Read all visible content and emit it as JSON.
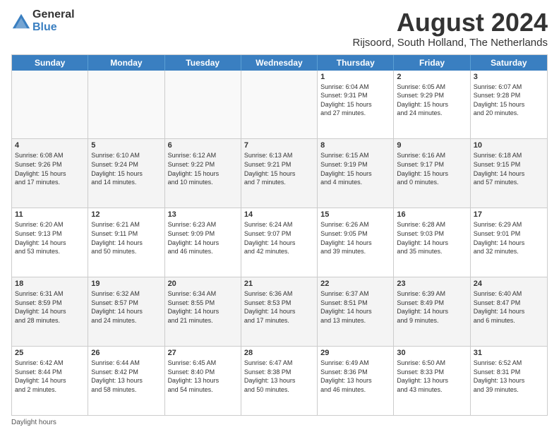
{
  "logo": {
    "general": "General",
    "blue": "Blue"
  },
  "title": {
    "month_year": "August 2024",
    "location": "Rijsoord, South Holland, The Netherlands"
  },
  "calendar": {
    "headers": [
      "Sunday",
      "Monday",
      "Tuesday",
      "Wednesday",
      "Thursday",
      "Friday",
      "Saturday"
    ],
    "footer": "Daylight hours",
    "rows": [
      [
        {
          "day": "",
          "info": ""
        },
        {
          "day": "",
          "info": ""
        },
        {
          "day": "",
          "info": ""
        },
        {
          "day": "",
          "info": ""
        },
        {
          "day": "1",
          "info": "Sunrise: 6:04 AM\nSunset: 9:31 PM\nDaylight: 15 hours\nand 27 minutes."
        },
        {
          "day": "2",
          "info": "Sunrise: 6:05 AM\nSunset: 9:29 PM\nDaylight: 15 hours\nand 24 minutes."
        },
        {
          "day": "3",
          "info": "Sunrise: 6:07 AM\nSunset: 9:28 PM\nDaylight: 15 hours\nand 20 minutes."
        }
      ],
      [
        {
          "day": "4",
          "info": "Sunrise: 6:08 AM\nSunset: 9:26 PM\nDaylight: 15 hours\nand 17 minutes."
        },
        {
          "day": "5",
          "info": "Sunrise: 6:10 AM\nSunset: 9:24 PM\nDaylight: 15 hours\nand 14 minutes."
        },
        {
          "day": "6",
          "info": "Sunrise: 6:12 AM\nSunset: 9:22 PM\nDaylight: 15 hours\nand 10 minutes."
        },
        {
          "day": "7",
          "info": "Sunrise: 6:13 AM\nSunset: 9:21 PM\nDaylight: 15 hours\nand 7 minutes."
        },
        {
          "day": "8",
          "info": "Sunrise: 6:15 AM\nSunset: 9:19 PM\nDaylight: 15 hours\nand 4 minutes."
        },
        {
          "day": "9",
          "info": "Sunrise: 6:16 AM\nSunset: 9:17 PM\nDaylight: 15 hours\nand 0 minutes."
        },
        {
          "day": "10",
          "info": "Sunrise: 6:18 AM\nSunset: 9:15 PM\nDaylight: 14 hours\nand 57 minutes."
        }
      ],
      [
        {
          "day": "11",
          "info": "Sunrise: 6:20 AM\nSunset: 9:13 PM\nDaylight: 14 hours\nand 53 minutes."
        },
        {
          "day": "12",
          "info": "Sunrise: 6:21 AM\nSunset: 9:11 PM\nDaylight: 14 hours\nand 50 minutes."
        },
        {
          "day": "13",
          "info": "Sunrise: 6:23 AM\nSunset: 9:09 PM\nDaylight: 14 hours\nand 46 minutes."
        },
        {
          "day": "14",
          "info": "Sunrise: 6:24 AM\nSunset: 9:07 PM\nDaylight: 14 hours\nand 42 minutes."
        },
        {
          "day": "15",
          "info": "Sunrise: 6:26 AM\nSunset: 9:05 PM\nDaylight: 14 hours\nand 39 minutes."
        },
        {
          "day": "16",
          "info": "Sunrise: 6:28 AM\nSunset: 9:03 PM\nDaylight: 14 hours\nand 35 minutes."
        },
        {
          "day": "17",
          "info": "Sunrise: 6:29 AM\nSunset: 9:01 PM\nDaylight: 14 hours\nand 32 minutes."
        }
      ],
      [
        {
          "day": "18",
          "info": "Sunrise: 6:31 AM\nSunset: 8:59 PM\nDaylight: 14 hours\nand 28 minutes."
        },
        {
          "day": "19",
          "info": "Sunrise: 6:32 AM\nSunset: 8:57 PM\nDaylight: 14 hours\nand 24 minutes."
        },
        {
          "day": "20",
          "info": "Sunrise: 6:34 AM\nSunset: 8:55 PM\nDaylight: 14 hours\nand 21 minutes."
        },
        {
          "day": "21",
          "info": "Sunrise: 6:36 AM\nSunset: 8:53 PM\nDaylight: 14 hours\nand 17 minutes."
        },
        {
          "day": "22",
          "info": "Sunrise: 6:37 AM\nSunset: 8:51 PM\nDaylight: 14 hours\nand 13 minutes."
        },
        {
          "day": "23",
          "info": "Sunrise: 6:39 AM\nSunset: 8:49 PM\nDaylight: 14 hours\nand 9 minutes."
        },
        {
          "day": "24",
          "info": "Sunrise: 6:40 AM\nSunset: 8:47 PM\nDaylight: 14 hours\nand 6 minutes."
        }
      ],
      [
        {
          "day": "25",
          "info": "Sunrise: 6:42 AM\nSunset: 8:44 PM\nDaylight: 14 hours\nand 2 minutes."
        },
        {
          "day": "26",
          "info": "Sunrise: 6:44 AM\nSunset: 8:42 PM\nDaylight: 13 hours\nand 58 minutes."
        },
        {
          "day": "27",
          "info": "Sunrise: 6:45 AM\nSunset: 8:40 PM\nDaylight: 13 hours\nand 54 minutes."
        },
        {
          "day": "28",
          "info": "Sunrise: 6:47 AM\nSunset: 8:38 PM\nDaylight: 13 hours\nand 50 minutes."
        },
        {
          "day": "29",
          "info": "Sunrise: 6:49 AM\nSunset: 8:36 PM\nDaylight: 13 hours\nand 46 minutes."
        },
        {
          "day": "30",
          "info": "Sunrise: 6:50 AM\nSunset: 8:33 PM\nDaylight: 13 hours\nand 43 minutes."
        },
        {
          "day": "31",
          "info": "Sunrise: 6:52 AM\nSunset: 8:31 PM\nDaylight: 13 hours\nand 39 minutes."
        }
      ]
    ]
  }
}
